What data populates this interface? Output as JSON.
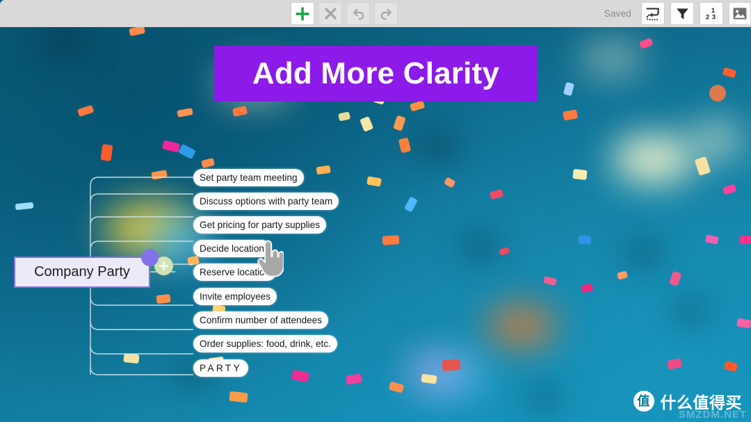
{
  "toolbar": {
    "status_text": "Saved",
    "buttons": [
      {
        "name": "add-node-button",
        "icon": "plus-icon",
        "label": "Add"
      },
      {
        "name": "delete-node-button",
        "icon": "close-x-icon",
        "label": "Delete"
      },
      {
        "name": "undo-button",
        "icon": "undo-arrow-icon",
        "label": "Undo"
      },
      {
        "name": "redo-button",
        "icon": "redo-arrow-icon",
        "label": "Redo"
      }
    ],
    "right_buttons": [
      {
        "name": "wrap-path-button",
        "icon": "dotted-return-arrow-icon",
        "label": "Wrap"
      },
      {
        "name": "filter-button",
        "icon": "funnel-filter-icon",
        "label": "Filter"
      },
      {
        "name": "numbering-button",
        "icon": "numbering-123-icon",
        "label": "Numbering"
      },
      {
        "name": "image-button",
        "icon": "picture-image-icon",
        "label": "Image"
      }
    ]
  },
  "banner": {
    "title": "Add More Clarity",
    "background_color": "#8c1ae8",
    "text_color": "#ffffff"
  },
  "mindmap": {
    "root": {
      "label": "Company Party",
      "border_color": "#8b6fe0",
      "background_color": "#eceaf6"
    },
    "add_child_label": "+",
    "children": [
      {
        "label": "Set party team meeting"
      },
      {
        "label": "Discuss options with party team"
      },
      {
        "label": "Get pricing for party supplies"
      },
      {
        "label": "Decide location"
      },
      {
        "label": "Reserve location"
      },
      {
        "label": "Invite employees"
      },
      {
        "label": "Confirm number of attendees"
      },
      {
        "label": "Order supplies: food, drink, etc."
      },
      {
        "label": "PARTY"
      }
    ]
  },
  "watermark": {
    "logo_char": "值",
    "text": "什么值得买",
    "subtext": "SMZDM.NET"
  },
  "theme": {
    "canvas_start": "#0b5d78",
    "canvas_end": "#1492b6",
    "toolbar_bg": "#d9d9da",
    "accent_purple": "#8472e8",
    "accent_green": "#16a84b",
    "node_bg": "#fdfdfd"
  }
}
